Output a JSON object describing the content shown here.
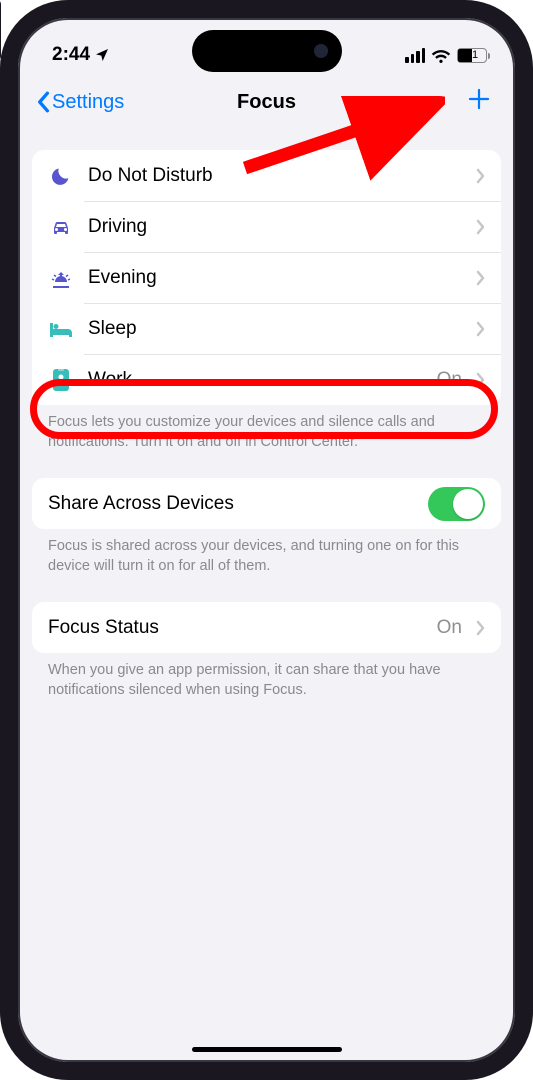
{
  "status": {
    "time": "2:44",
    "battery_pct": "51"
  },
  "nav": {
    "back_label": "Settings",
    "title": "Focus"
  },
  "focus_modes": [
    {
      "key": "dnd",
      "label": "Do Not Disturb",
      "icon": "moon",
      "icon_color": "#5856cf",
      "status": ""
    },
    {
      "key": "driving",
      "label": "Driving",
      "icon": "car",
      "icon_color": "#5856cf",
      "status": ""
    },
    {
      "key": "evening",
      "label": "Evening",
      "icon": "sunset",
      "icon_color": "#5856cf",
      "status": ""
    },
    {
      "key": "sleep",
      "label": "Sleep",
      "icon": "bed",
      "icon_color": "#39bdba",
      "status": ""
    },
    {
      "key": "work",
      "label": "Work",
      "icon": "badge",
      "icon_color": "#39bdba",
      "status": "On"
    }
  ],
  "focus_modes_footer": "Focus lets you customize your devices and silence calls and notifications. Turn it on and off in Control Center.",
  "share": {
    "label": "Share Across Devices",
    "on": true,
    "footer": "Focus is shared across your devices, and turning one on for this device will turn it on for all of them."
  },
  "focus_status": {
    "label": "Focus Status",
    "value": "On",
    "footer": "When you give an app permission, it can share that you have notifications silenced when using Focus."
  },
  "annotation": {
    "arrow_points_to": "add-focus-button",
    "circled_row": "work"
  }
}
